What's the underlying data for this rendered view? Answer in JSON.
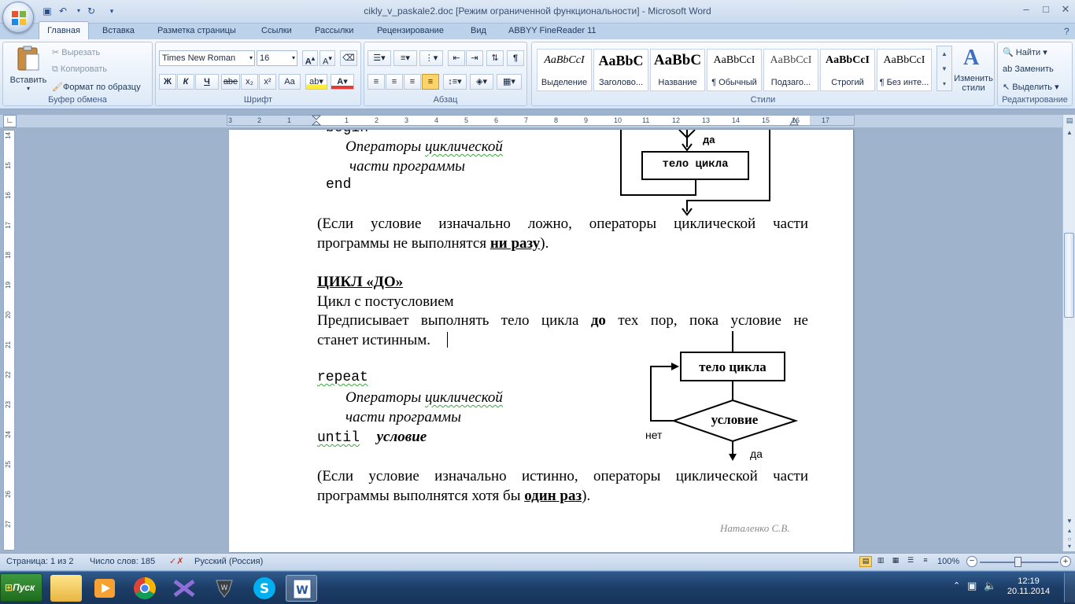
{
  "window": {
    "title": "cikly_v_paskale2.doc [Режим ограниченной функциональности] - Microsoft Word",
    "controls": {
      "minimize": "–",
      "maximize": "□",
      "close": "✕"
    }
  },
  "ribbon": {
    "tabs": [
      "Главная",
      "Вставка",
      "Разметка страницы",
      "Ссылки",
      "Рассылки",
      "Рецензирование",
      "Вид",
      "ABBYY FineReader 11"
    ],
    "clipboard": {
      "paste": "Вставить",
      "cut": "Вырезать",
      "copy": "Копировать",
      "format_painter": "Формат по образцу",
      "label": "Буфер обмена"
    },
    "font": {
      "name": "Times New Roman",
      "size": "16",
      "bold": "Ж",
      "italic": "К",
      "underline": "Ч",
      "strike": "abe",
      "sub": "x₂",
      "sup": "x²",
      "case": "Aa",
      "label": "Шрифт"
    },
    "paragraph": {
      "label": "Абзац"
    },
    "styles": {
      "label": "Стили",
      "change_styles": "Изменить стили",
      "items": [
        {
          "sample": "AaBbCcI",
          "name": "Выделение"
        },
        {
          "sample": "AaBbC",
          "name": "Заголово..."
        },
        {
          "sample": "AaBbC",
          "name": "Название"
        },
        {
          "sample": "AaBbCcI",
          "name": "¶ Обычный"
        },
        {
          "sample": "AaBbCcI",
          "name": "Подзаго..."
        },
        {
          "sample": "AaBbCcI",
          "name": "Строгий"
        },
        {
          "sample": "AaBbCcI",
          "name": "¶ Без инте..."
        }
      ]
    },
    "editing": {
      "find": "Найти",
      "replace": "Заменить",
      "select": "Выделить",
      "label": "Редактирование"
    }
  },
  "ruler": {
    "h_ticks": [
      "3",
      "2",
      "1",
      "1",
      "2",
      "3",
      "4",
      "5",
      "6",
      "7",
      "8",
      "9",
      "10",
      "11",
      "12",
      "13",
      "14",
      "15",
      "16",
      "17"
    ],
    "v_ticks": [
      "14",
      "15",
      "16",
      "17",
      "18",
      "19",
      "20",
      "21",
      "22",
      "23",
      "24",
      "25",
      "26",
      "27"
    ]
  },
  "document": {
    "begin": "begin",
    "ops1a": "Операторы",
    "ops1b": "циклической",
    "parts1a": "части",
    "parts1b": "программы",
    "end": "end",
    "diag1_yes": "да",
    "diag1_body": "тело цикла",
    "note1_line1": "(Если условие изначально ложно, операторы циклической части",
    "note1_line2a": "программы не выполнятся ",
    "note1_bold": "ни разу",
    "note1_line2b": ").",
    "heading": "ЦИКЛ «ДО»",
    "subheading": "Цикл с постусловием",
    "desc_line1a": "Предписывает выполнять тело цикла ",
    "desc_bold": "до",
    "desc_line1b": " тех пор, пока условие не",
    "desc_line2": "станет истинным.",
    "repeat": "repeat",
    "ops2a": "Операторы",
    "ops2b": "циклической",
    "parts2a": "части",
    "parts2b": "программы",
    "until": "until",
    "until_cond": "условие",
    "diag2_body": "тело цикла",
    "diag2_cond": "условие",
    "diag2_no": "нет",
    "diag2_yes": "да",
    "note2_line1": "(Если условие изначально истинно, операторы циклической части",
    "note2_line2a": "программы выполнятся хотя бы ",
    "note2_bold": "один раз",
    "note2_line2b": ").",
    "author": "Наталенко С.В."
  },
  "status": {
    "page": "Страница: 1 из 2",
    "words": "Число слов: 185",
    "lang": "Русский (Россия)",
    "zoom": "100%"
  },
  "taskbar": {
    "start": "Пуск",
    "time": "12:19",
    "date": "20.11.2014"
  }
}
